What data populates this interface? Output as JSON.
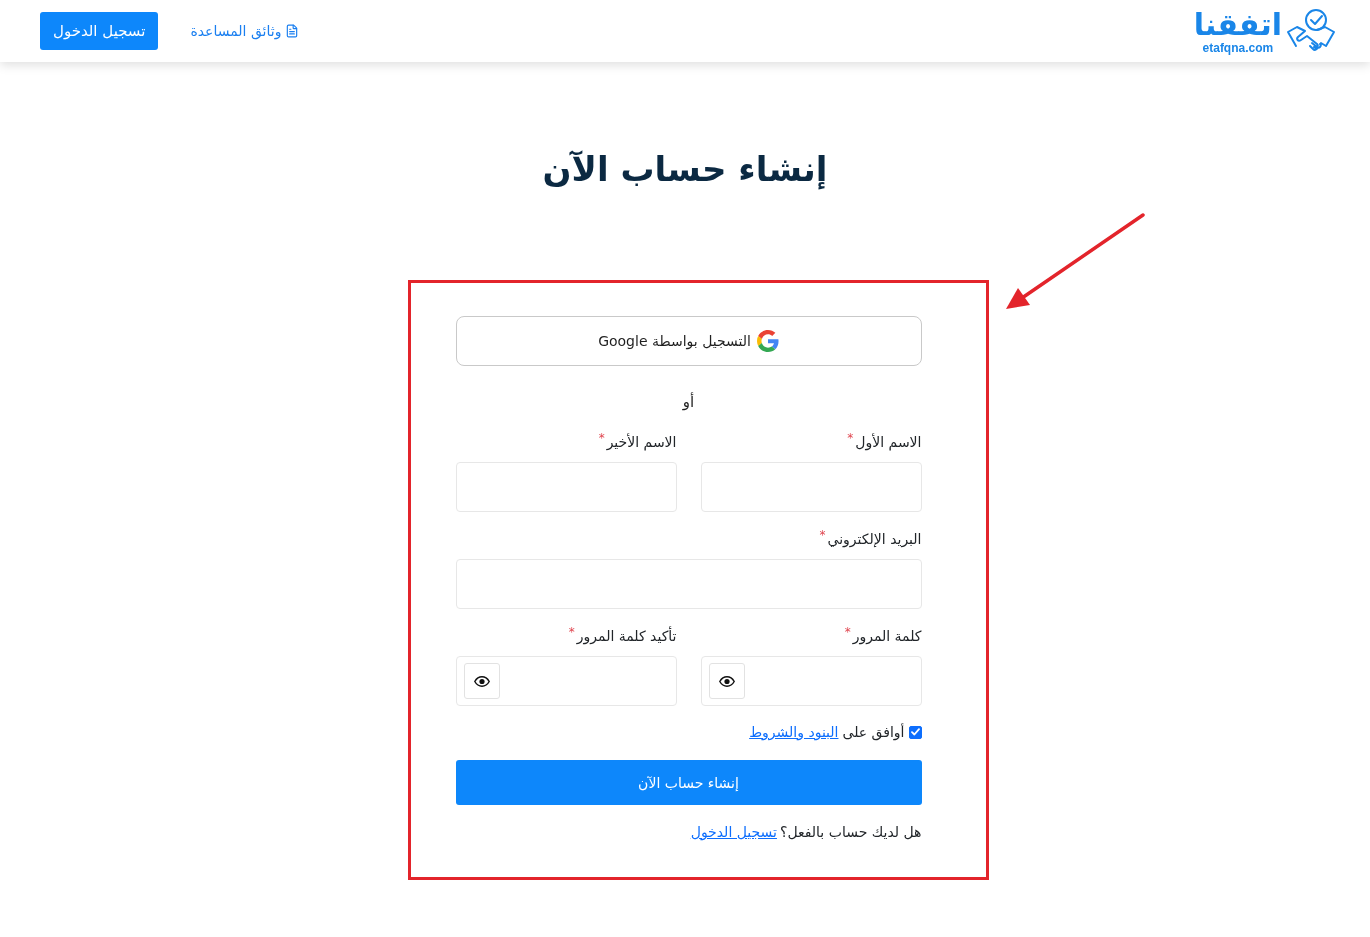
{
  "header": {
    "logo": {
      "name": "اتفقنا",
      "domain": "etafqna.com"
    },
    "help_link": "وثائق المساعدة",
    "login_button": "تسجيل الدخول"
  },
  "page_title": "إنشاء حساب الآن",
  "signup_form": {
    "google_button": "التسجيل بواسطة Google",
    "divider": "أو",
    "rows": [
      {
        "fields": [
          {
            "kind": "text",
            "label": "الاسم الأول",
            "required_mark": "*"
          },
          {
            "kind": "text",
            "label": "الاسم الأخير",
            "required_mark": "*"
          }
        ]
      },
      {
        "fields": [
          {
            "kind": "email",
            "label": "البريد الإلكتروني",
            "required_mark": "*"
          }
        ]
      },
      {
        "fields": [
          {
            "kind": "password",
            "label": "كلمة المرور",
            "required_mark": "*"
          },
          {
            "kind": "password",
            "label": "تأكيد كلمة المرور",
            "required_mark": "*"
          }
        ]
      }
    ],
    "terms": {
      "checked": true,
      "text": "أوافق على",
      "link": "البنود والشروط"
    },
    "submit_button": "إنشاء حساب الآن",
    "login_prompt": {
      "text": "هل لديك حساب بالفعل؟",
      "link": "تسجيل الدخول"
    }
  }
}
